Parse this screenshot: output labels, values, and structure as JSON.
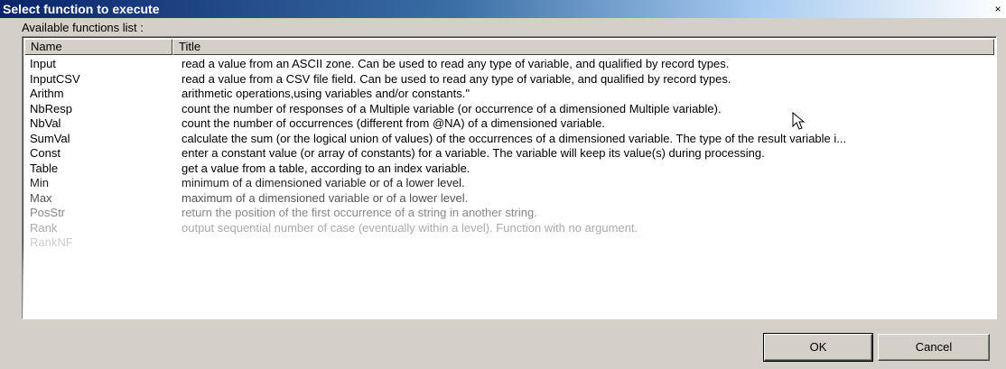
{
  "window": {
    "title": "Select function to execute",
    "close_glyph": "×"
  },
  "label": "Available functions list :",
  "columns": {
    "name": "Name",
    "title": "Title"
  },
  "rows": [
    {
      "name": "Input",
      "title": "read a value from an ASCII zone. Can be used to read any type of variable, and qualified by record types.",
      "opacity": 1
    },
    {
      "name": "InputCSV",
      "title": "read a value from a CSV file field. Can be used to read any type of variable, and qualified by record types.",
      "opacity": 1
    },
    {
      "name": "Arithm",
      "title": "arithmetic operations,using variables and/or constants.\"",
      "opacity": 1
    },
    {
      "name": "NbResp",
      "title": "count the number of responses of a Multiple variable (or occurrence of a dimensioned Multiple variable).",
      "opacity": 1
    },
    {
      "name": "NbVal",
      "title": "count the number of occurrences (different from @NA) of a dimensioned variable.",
      "opacity": 1
    },
    {
      "name": "SumVal",
      "title": "calculate the sum (or the logical union of values) of the occurrences of a dimensioned variable. The type of the result variable i...",
      "opacity": 1
    },
    {
      "name": "Const",
      "title": "enter a constant value (or array of constants) for a variable. The variable will keep its value(s) during processing.",
      "opacity": 1
    },
    {
      "name": "Table",
      "title": "get a value from a table, according to an index variable.",
      "opacity": 1
    },
    {
      "name": "Min",
      "title": "minimum of a dimensioned variable or of a lower level.",
      "opacity": 1
    },
    {
      "name": "Max",
      "title": "maximum of a dimensioned variable or of a lower level.",
      "opacity": 1
    },
    {
      "name": "PosStr",
      "title": "return the position of the first occurrence of a string in another string.",
      "opacity": 1
    },
    {
      "name": "Rank",
      "title": "output sequential number of case (eventually within a level). Function with no argument.",
      "opacity": 1
    },
    {
      "name": "RankNF",
      "title": "",
      "opacity": 1
    }
  ],
  "buttons": {
    "ok": "OK",
    "cancel": "Cancel"
  },
  "colors": {
    "titlebar_start": "#0a246a",
    "face": "#d4d0c8"
  },
  "icons": {
    "cursor": "mouse-pointer-icon"
  }
}
